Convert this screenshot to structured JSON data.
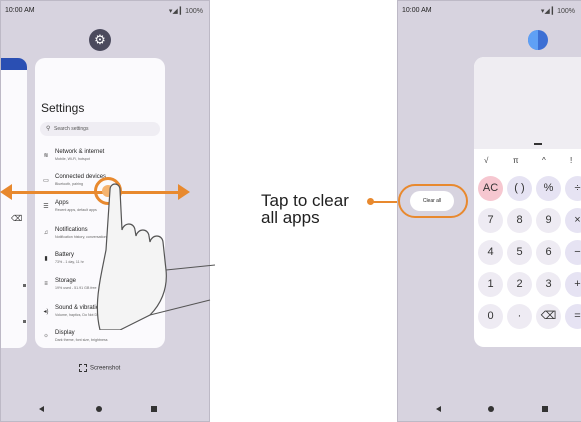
{
  "left_phone": {
    "status_time": "10:00 AM",
    "status_battery": "▾◢ ▎100%",
    "settings_card": {
      "title": "Settings",
      "search_placeholder": "Search settings",
      "items": [
        {
          "title": "Network & internet",
          "subtitle": "Mobile, Wi-Fi, hotspot",
          "icon": "wifi-icon"
        },
        {
          "title": "Connected devices",
          "subtitle": "Bluetooth, pairing",
          "icon": "devices-icon"
        },
        {
          "title": "Apps",
          "subtitle": "Recent apps, default apps",
          "icon": "apps-icon"
        },
        {
          "title": "Notifications",
          "subtitle": "Notification history, conversations",
          "icon": "bell-icon"
        },
        {
          "title": "Battery",
          "subtitle": "73% - 1 day, 11 hr",
          "icon": "battery-icon"
        },
        {
          "title": "Storage",
          "subtitle": "19% used - 51.91 GB free",
          "icon": "storage-icon"
        },
        {
          "title": "Sound & vibration",
          "subtitle": "Volume, haptics, Do Not Disturb",
          "icon": "sound-icon"
        },
        {
          "title": "Display",
          "subtitle": "Dark theme, font size, brightness",
          "icon": "display-icon"
        }
      ]
    },
    "screenshot_label": "Screenshot"
  },
  "callout": {
    "line1": "Tap to clear",
    "line2": "all apps",
    "accent_color": "#e8892e"
  },
  "right_phone": {
    "status_time": "10:00 AM",
    "status_battery": "▾◢ ▎100%",
    "clear_all_label": "Clear all",
    "calculator": {
      "sci_row": [
        "√",
        "π",
        "^",
        "!"
      ],
      "keys": [
        [
          "AC",
          "( )",
          "%",
          "÷"
        ],
        [
          "7",
          "8",
          "9",
          "×"
        ],
        [
          "4",
          "5",
          "6",
          "−"
        ],
        [
          "1",
          "2",
          "3",
          "+"
        ],
        [
          "0",
          "·",
          "⌫",
          "="
        ]
      ]
    }
  }
}
